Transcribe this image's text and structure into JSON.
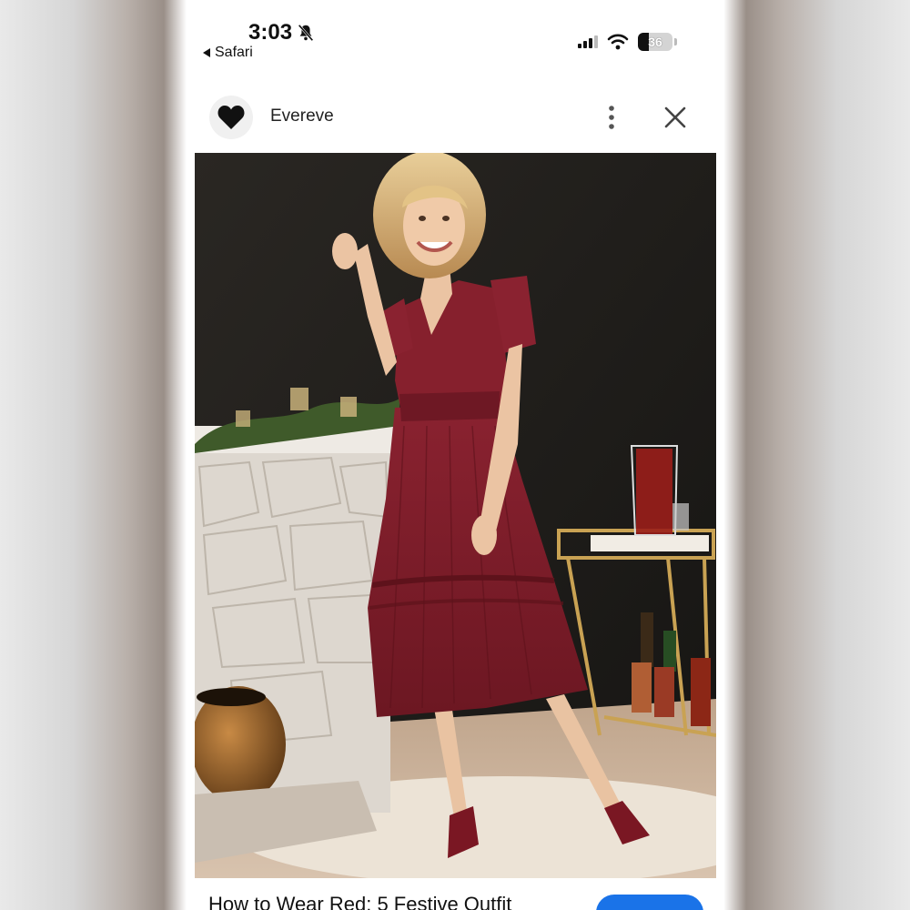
{
  "status_bar": {
    "time": "3:03",
    "back_label": "Safari",
    "battery_level": "36"
  },
  "header": {
    "brand_name": "Evereve"
  },
  "photo": {
    "dress_color": "#7a1c26",
    "wall_color": "#1f1d1a"
  },
  "article": {
    "title": "How to Wear Red: 5 Festive Outfit"
  },
  "colors": {
    "accent": "#1a73e8"
  }
}
